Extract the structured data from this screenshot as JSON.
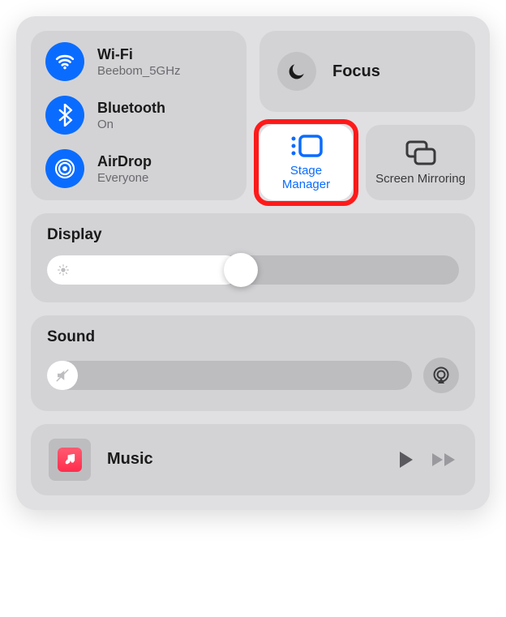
{
  "connectivity": {
    "wifi": {
      "title": "Wi-Fi",
      "status": "Beebom_5GHz",
      "active": true
    },
    "bluetooth": {
      "title": "Bluetooth",
      "status": "On",
      "active": true
    },
    "airdrop": {
      "title": "AirDrop",
      "status": "Everyone",
      "active": true
    }
  },
  "focus": {
    "title": "Focus",
    "active": false
  },
  "stage_manager": {
    "label": "Stage Manager",
    "active": true,
    "highlighted": true
  },
  "screen_mirroring": {
    "label": "Screen Mirroring",
    "active": false
  },
  "display": {
    "title": "Display",
    "brightness_percent": 47
  },
  "sound": {
    "title": "Sound",
    "volume_percent": 0,
    "muted": true
  },
  "music": {
    "app": "Music",
    "playing": false
  }
}
